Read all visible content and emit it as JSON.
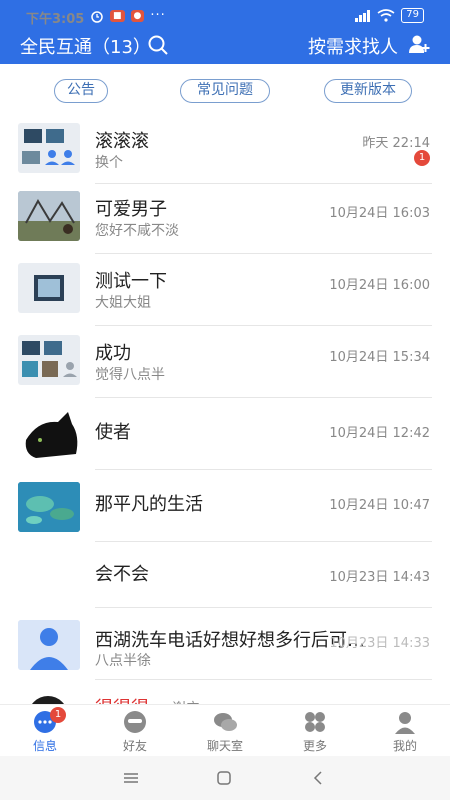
{
  "status": {
    "time": "下午3:05",
    "battery": "79",
    "more": "···"
  },
  "header": {
    "title": "全民互通（13）",
    "find_people": "按需求找人"
  },
  "pills": [
    "公告",
    "常见问题",
    "更新版本"
  ],
  "conversations": [
    {
      "name": "滚滚滚",
      "preview": "换个",
      "time": "昨天 22:14",
      "unread": "1"
    },
    {
      "name": "可爱男子",
      "preview": "您好不咸不淡",
      "time": "10月24日 16:03"
    },
    {
      "name": "测试一下",
      "preview": "大姐大姐",
      "time": "10月24日 16:00"
    },
    {
      "name": "成功",
      "preview": "觉得八点半",
      "time": "10月24日 15:34"
    },
    {
      "name": "使者",
      "preview": "",
      "time": "10月24日 12:42"
    },
    {
      "name": "那平凡的生活",
      "preview": "",
      "time": "10月24日 10:47"
    },
    {
      "name": "会不会",
      "preview": "",
      "time": "10月23日 14:43"
    },
    {
      "name": "西湖洗车电话好想好想多行后可…",
      "preview": "八点半徐",
      "time": "10月23日 14:33"
    },
    {
      "name": "得得得",
      "preview": "谢宁",
      "time": ""
    }
  ],
  "bottom_nav": {
    "items": [
      {
        "label": "信息",
        "badge": "1"
      },
      {
        "label": "好友"
      },
      {
        "label": "聊天室"
      },
      {
        "label": "更多"
      },
      {
        "label": "我的"
      }
    ]
  },
  "colors": {
    "primary": "#2f6fe4",
    "badge": "#e4493b",
    "pill_border": "#7a9ecf"
  }
}
